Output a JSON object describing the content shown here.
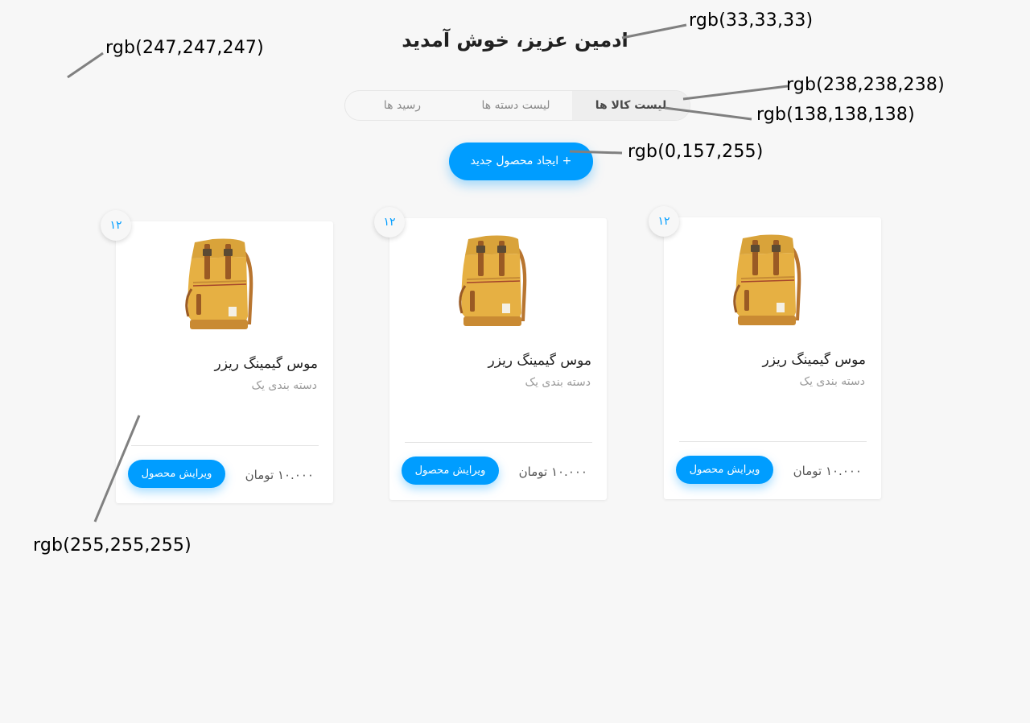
{
  "header": {
    "title": "ادمین عزیز، خوش آمدید"
  },
  "tabs": [
    {
      "label": "لیست کالا ها",
      "active": true
    },
    {
      "label": "لیست دسته ها",
      "active": false
    },
    {
      "label": "رسید ها",
      "active": false
    }
  ],
  "create_button": {
    "label": "+ ایجاد محصول جدید"
  },
  "products": [
    {
      "badge": "۱۲",
      "name": "موس گیمینگ ریزر",
      "category": "دسته بندی یک",
      "price": "۱۰.۰۰۰ تومان",
      "edit_label": "ویرایش محصول"
    },
    {
      "badge": "۱۲",
      "name": "موس گیمینگ ریزر",
      "category": "دسته بندی یک",
      "price": "۱۰.۰۰۰ تومان",
      "edit_label": "ویرایش محصول"
    },
    {
      "badge": "۱۲",
      "name": "موس گیمینگ ریزر",
      "category": "دسته بندی یک",
      "price": "۱۰.۰۰۰ تومان",
      "edit_label": "ویرایش محصول"
    }
  ],
  "annotations": {
    "background": "rgb(247,247,247)",
    "title_color": "rgb(33,33,33)",
    "tab_active_bg": "rgb(238,238,238)",
    "tab_text": "rgb(138,138,138)",
    "primary": "rgb(0,157,255)",
    "card_bg": "rgb(255,255,255)"
  },
  "colors": {
    "background": "#f7f7f7",
    "title": "#212121",
    "tab_active_bg": "#eeeeee",
    "tab_text": "#8a8a8a",
    "primary": "#009dff",
    "card": "#ffffff"
  }
}
